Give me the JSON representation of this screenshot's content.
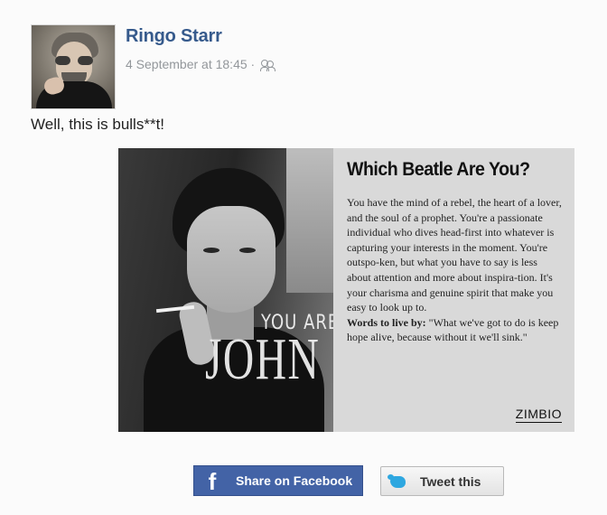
{
  "post": {
    "author": "Ringo Starr",
    "timestamp": "4 September at 18:45 ·",
    "audience_icon": "friends-icon",
    "message": "Well, this is bulls**t!"
  },
  "quiz_card": {
    "overlay_top": "YOU ARE",
    "overlay_name": "JOHN",
    "title": "Which Beatle Are You?",
    "description": "You have the mind of a rebel, the heart of a lover, and the soul of a prophet. You're a passionate individual who dives head-first into whatever is capturing your interests in the moment. You're outspo-ken, but what you have to say is less about attention and more about inspira-tion. It's your charisma and genuine spirit that make you easy to look up to.",
    "words_label": "Words to live by:",
    "words_quote": " \"What we've got to do is keep hope alive, because without it we'll sink.\"",
    "brand": "ZIMBIO"
  },
  "buttons": {
    "share_facebook": "Share on Facebook",
    "tweet": "Tweet this"
  },
  "colors": {
    "author_link": "#365a8c",
    "facebook_button": "#4363a6",
    "twitter_bird": "#2ea7e0"
  }
}
